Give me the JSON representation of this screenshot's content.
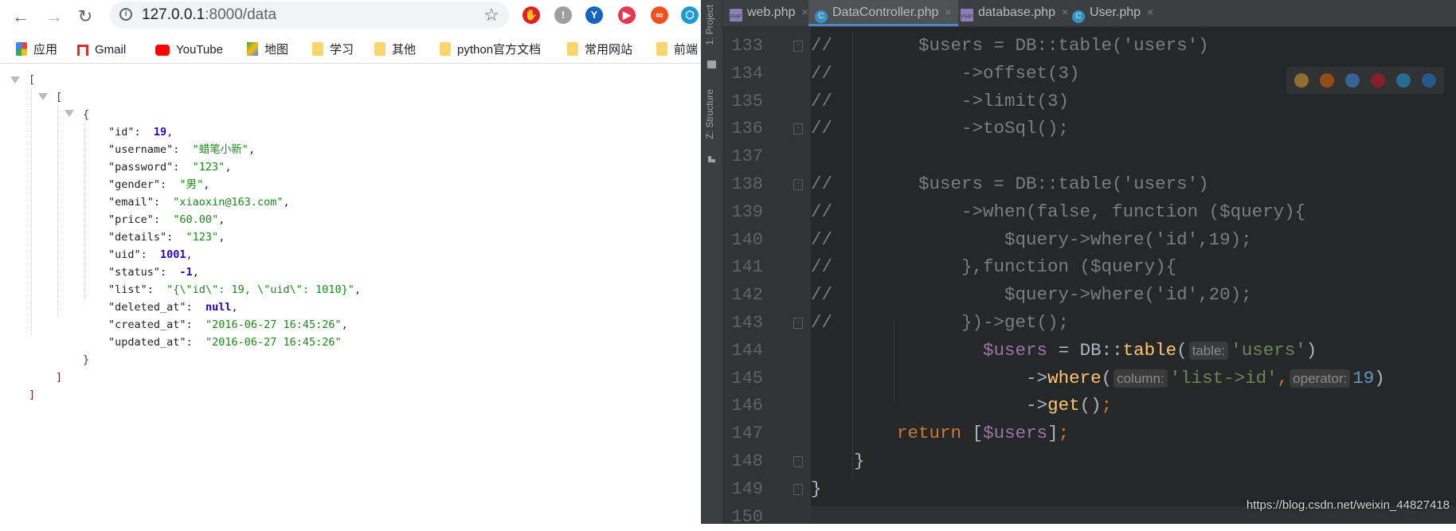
{
  "browser": {
    "url_host": "127.0.0.1",
    "url_path": ":8000/data",
    "extensions": [
      {
        "icon": "adblock-icon",
        "color": "#e21f26",
        "glyph": "✋"
      },
      {
        "icon": "puzzle-warning-icon",
        "color": "#9e9e9e",
        "glyph": "!"
      },
      {
        "icon": "vpn-pin-icon",
        "color": "#1565c0",
        "glyph": "Y"
      },
      {
        "icon": "media-icon",
        "color": "#e53950",
        "glyph": "▶"
      },
      {
        "icon": "infinity-icon",
        "color": "#f4511e",
        "glyph": "∞"
      },
      {
        "icon": "hex-icon",
        "color": "#1e9ad6",
        "glyph": "⬡"
      }
    ],
    "bookmarks": [
      {
        "label": "应用",
        "icon": "apps-grid-icon"
      },
      {
        "label": "Gmail",
        "icon": "gmail-icon"
      },
      {
        "label": "YouTube",
        "icon": "youtube-icon"
      },
      {
        "label": "地图",
        "icon": "maps-icon"
      },
      {
        "label": "学习",
        "icon": "folder-icon"
      },
      {
        "label": "其他",
        "icon": "folder-icon"
      },
      {
        "label": "python官方文档",
        "icon": "folder-icon"
      },
      {
        "label": "常用网站",
        "icon": "folder-icon"
      },
      {
        "label": "前端",
        "icon": "folder-icon"
      }
    ],
    "json": {
      "open_outer": "[",
      "open_inner": "[",
      "open_obj": "{",
      "close_obj": "}",
      "close_inner": "]",
      "close_outer": "]",
      "fields": [
        {
          "key": "\"id\"",
          "value": "19",
          "type": "num",
          "comma": ","
        },
        {
          "key": "\"username\"",
          "value": "\"蜡笔小新\"",
          "type": "str",
          "comma": ","
        },
        {
          "key": "\"password\"",
          "value": "\"123\"",
          "type": "str",
          "comma": ","
        },
        {
          "key": "\"gender\"",
          "value": "\"男\"",
          "type": "str",
          "comma": ","
        },
        {
          "key": "\"email\"",
          "value": "\"xiaoxin@163.com\"",
          "type": "str",
          "comma": ","
        },
        {
          "key": "\"price\"",
          "value": "\"60.00\"",
          "type": "str",
          "comma": ","
        },
        {
          "key": "\"details\"",
          "value": "\"123\"",
          "type": "str",
          "comma": ","
        },
        {
          "key": "\"uid\"",
          "value": "1001",
          "type": "num",
          "comma": ","
        },
        {
          "key": "\"status\"",
          "value": "-1",
          "type": "num",
          "comma": ","
        },
        {
          "key": "\"list\"",
          "value": "\"{\\\"id\\\": 19, \\\"uid\\\": 1010}\"",
          "type": "str",
          "comma": ","
        },
        {
          "key": "\"deleted_at\"",
          "value": "null",
          "type": "num",
          "comma": ","
        },
        {
          "key": "\"created_at\"",
          "value": "\"2016-06-27 16:45:26\"",
          "type": "str",
          "comma": ","
        },
        {
          "key": "\"updated_at\"",
          "value": "\"2016-06-27 16:45:26\"",
          "type": "str",
          "comma": ""
        }
      ]
    }
  },
  "ide": {
    "side_labels": {
      "project": "1: Project",
      "structure": "Z: Structure"
    },
    "tabs": [
      {
        "label": "web.php",
        "icon": "php-file-icon",
        "active": false
      },
      {
        "label": "DataController.php",
        "icon": "php-class-icon",
        "active": true
      },
      {
        "label": "database.php",
        "icon": "php-file-icon",
        "active": false
      },
      {
        "label": "User.php",
        "icon": "php-class-icon",
        "active": false
      }
    ],
    "close_glyph": "×",
    "lines": [
      {
        "n": "133",
        "fold": true,
        "tokens": [
          [
            "//        $users = DB::table('users')",
            "c"
          ]
        ]
      },
      {
        "n": "134",
        "fold": false,
        "tokens": [
          [
            "//            ->offset(3)",
            "c"
          ]
        ]
      },
      {
        "n": "135",
        "fold": false,
        "tokens": [
          [
            "//            ->limit(3)",
            "c"
          ]
        ]
      },
      {
        "n": "136",
        "fold": true,
        "tokens": [
          [
            "//            ->toSql();",
            "c"
          ]
        ]
      },
      {
        "n": "137",
        "fold": false,
        "tokens": []
      },
      {
        "n": "138",
        "fold": true,
        "tokens": [
          [
            "//        $users = DB::table('users')",
            "c"
          ]
        ]
      },
      {
        "n": "139",
        "fold": false,
        "tokens": [
          [
            "//            ->when(false, function ($query){",
            "c"
          ]
        ]
      },
      {
        "n": "140",
        "fold": false,
        "tokens": [
          [
            "//                $query->where('id',19);",
            "c"
          ]
        ]
      },
      {
        "n": "141",
        "fold": false,
        "tokens": [
          [
            "//            },function ($query){",
            "c"
          ]
        ]
      },
      {
        "n": "142",
        "fold": false,
        "tokens": [
          [
            "//                $query->where('id',20);",
            "c"
          ]
        ]
      },
      {
        "n": "143",
        "fold": true,
        "tokens": [
          [
            "//            })->get();",
            "c"
          ]
        ]
      },
      {
        "n": "144",
        "fold": false,
        "tokens": [
          [
            "                ",
            "p"
          ],
          [
            "$users",
            "v"
          ],
          [
            " = DB::",
            "p"
          ],
          [
            "table",
            "f"
          ],
          [
            "(",
            "p"
          ],
          [
            "table:",
            "h"
          ],
          [
            "'users'",
            "s"
          ],
          [
            ")",
            "p"
          ]
        ]
      },
      {
        "n": "145",
        "fold": false,
        "tokens": [
          [
            "                    ->",
            "p"
          ],
          [
            "where",
            "f"
          ],
          [
            "(",
            "p"
          ],
          [
            "column:",
            "h"
          ],
          [
            "'list->id'",
            "s"
          ],
          [
            ",",
            "k"
          ],
          [
            "operator:",
            "h"
          ],
          [
            "19",
            "n"
          ],
          [
            ")",
            "p"
          ]
        ]
      },
      {
        "n": "146",
        "fold": false,
        "tokens": [
          [
            "                    ->",
            "p"
          ],
          [
            "get",
            "f"
          ],
          [
            "()",
            "p"
          ],
          [
            ";",
            "k"
          ]
        ]
      },
      {
        "n": "147",
        "fold": false,
        "tokens": [
          [
            "        ",
            "p"
          ],
          [
            "return",
            "k"
          ],
          [
            " [",
            "p"
          ],
          [
            "$users",
            "v"
          ],
          [
            "]",
            "p"
          ],
          [
            ";",
            "k"
          ]
        ]
      },
      {
        "n": "148",
        "fold": true,
        "tokens": [
          [
            "    }",
            "p"
          ]
        ]
      },
      {
        "n": "149",
        "fold": true,
        "tokens": [
          [
            "}",
            "p"
          ]
        ]
      },
      {
        "n": "150",
        "fold": false,
        "tokens": []
      }
    ],
    "browser_popup_icons": [
      {
        "icon": "chrome-icon",
        "color": "#e0a030"
      },
      {
        "icon": "firefox-icon",
        "color": "#e66000"
      },
      {
        "icon": "safari-icon",
        "color": "#3a8ee6"
      },
      {
        "icon": "opera-icon",
        "color": "#d01020"
      },
      {
        "icon": "ie-icon",
        "color": "#1ea0e0"
      },
      {
        "icon": "edge-icon",
        "color": "#1e7ad6"
      }
    ]
  },
  "watermark": "https://blog.csdn.net/weixin_44827418"
}
